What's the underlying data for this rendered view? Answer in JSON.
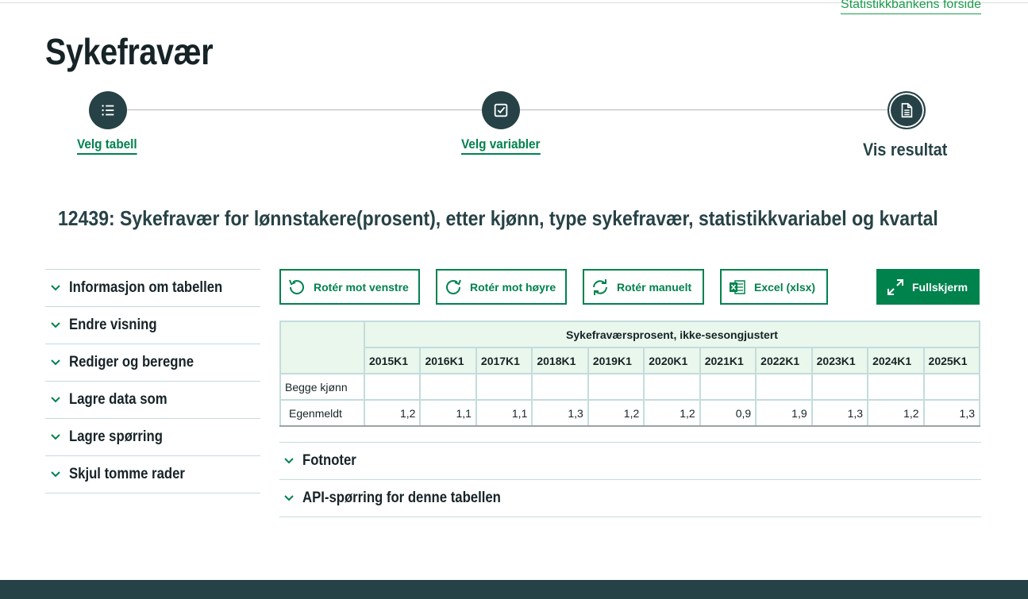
{
  "header": {
    "home_link": "Statistikkbankens forside",
    "page_title": "Sykefravær"
  },
  "stepper": {
    "steps": [
      {
        "label": "Velg tabell",
        "icon": "list-icon"
      },
      {
        "label": "Velg variabler",
        "icon": "checkbox-icon"
      },
      {
        "label": "Vis resultat",
        "icon": "document-icon"
      }
    ]
  },
  "table_title": "12439: Sykefravær for lønnstakere(prosent), etter kjønn, type sykefravær, statistikkvariabel og kvartal",
  "sidebar": {
    "items": [
      {
        "label": "Informasjon om tabellen"
      },
      {
        "label": "Endre visning"
      },
      {
        "label": "Rediger og beregne"
      },
      {
        "label": "Lagre data som"
      },
      {
        "label": "Lagre spørring"
      },
      {
        "label": "Skjul tomme rader"
      }
    ]
  },
  "toolbar": {
    "rotate_left": "Rotér mot venstre",
    "rotate_right": "Rotér mot høyre",
    "rotate_manual": "Rotér manuelt",
    "excel": "Excel (xlsx)",
    "fullscreen": "Fullskjerm"
  },
  "table": {
    "header_main": "Sykefraværsprosent, ikke-sesongjustert",
    "columns": [
      "2015K1",
      "2016K1",
      "2017K1",
      "2018K1",
      "2019K1",
      "2020K1",
      "2021K1",
      "2022K1",
      "2023K1",
      "2024K1",
      "2025K1"
    ],
    "group_row": "Begge kjønn",
    "data_row": {
      "label": "Egenmeldt",
      "values": [
        "1,2",
        "1,1",
        "1,1",
        "1,3",
        "1,2",
        "1,2",
        "0,9",
        "1,9",
        "1,3",
        "1,2",
        "1,3"
      ]
    }
  },
  "accordions": {
    "footnotes": "Fotnoter",
    "api": "API-spørring for denne tabellen"
  },
  "colors": {
    "accent_green": "#00824d",
    "dark": "#274247",
    "table_header_bg": "#e9f7ec"
  }
}
